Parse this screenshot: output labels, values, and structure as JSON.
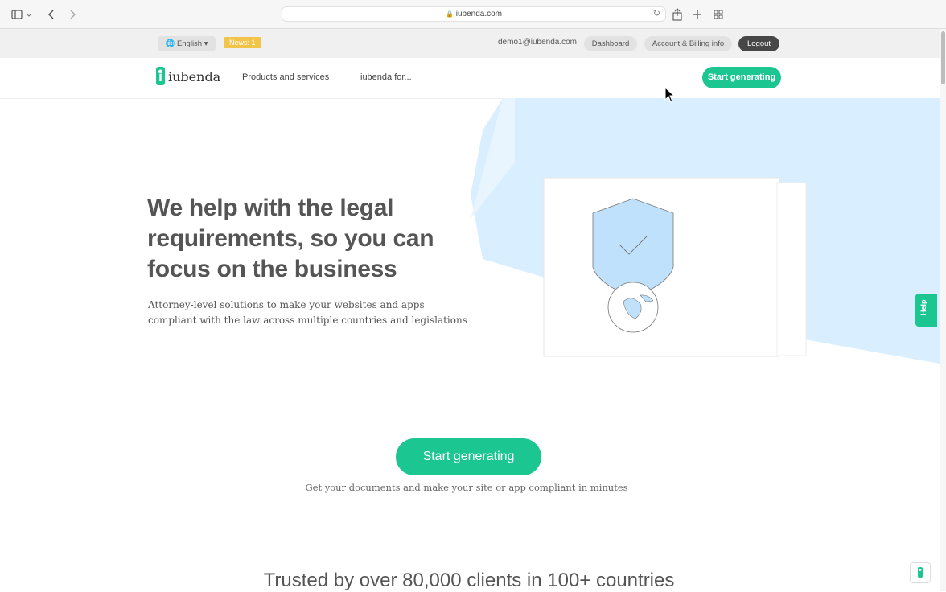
{
  "browser": {
    "url": "iubenda.com",
    "lock_icon": "lock-icon",
    "sidebar_icon": "sidebar-icon",
    "back_icon": "chevron-left-icon",
    "forward_icon": "chevron-right-icon",
    "reload_icon": "reload-icon",
    "share_icon": "share-icon",
    "newtab_icon": "plus-icon",
    "tabs_icon": "tab-grid-icon"
  },
  "account_bar": {
    "language": "English",
    "news": "News: 1",
    "email": "demo1@iubenda.com",
    "dashboard": "Dashboard",
    "billing": "Account & Billing info",
    "logout": "Logout"
  },
  "nav": {
    "logo_text": "iubenda",
    "links": [
      "Products and services",
      "iubenda for..."
    ],
    "cta": "Start generating"
  },
  "hero": {
    "title": "We help with the legal requirements, so you can focus on the business",
    "subtitle": "Attorney-level solutions to make your websites and apps compliant with the law across multiple countries and legislations",
    "cta": "Start generating",
    "cta_note": "Get your documents and make your site or app compliant in minutes"
  },
  "trusted": "Trusted by over 80,000 clients in 100+ countries",
  "help": "Help",
  "colors": {
    "brand_green": "#1cc691",
    "news_yellow": "#f3c44a",
    "hero_blue": "#d9efff"
  }
}
